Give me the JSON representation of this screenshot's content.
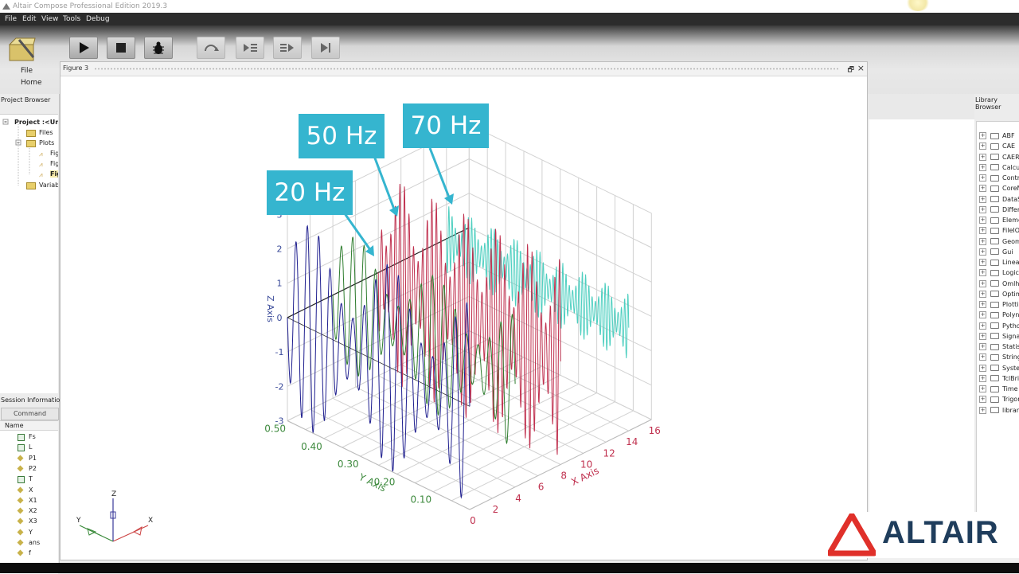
{
  "window": {
    "title": "Altair Compose Professional Edition 2019.3"
  },
  "menu": [
    "File",
    "Edit",
    "View",
    "Tools",
    "Debug"
  ],
  "ribbon": {
    "file_label": "File",
    "home_label": "Home"
  },
  "project_browser": {
    "title": "Project Browser",
    "project": "Project :<Untitled>",
    "files": "Files",
    "plots": "Plots",
    "figures": [
      "Fig",
      "Fig",
      "Fig"
    ],
    "variables": "Variables"
  },
  "session": {
    "title": "Session Information",
    "tab": "Command History",
    "column": "Name",
    "vars": [
      "Fs",
      "L",
      "P1",
      "P2",
      "T",
      "X",
      "X1",
      "X2",
      "X3",
      "Y",
      "ans",
      "f"
    ]
  },
  "figure": {
    "title": "Figure 3",
    "restore_glyph": "🗗",
    "close_glyph": "×"
  },
  "library": {
    "title": "Library Browser",
    "items": [
      "ABF",
      "CAE",
      "CAERead",
      "Calculus",
      "Control",
      "CoreMinimal",
      "DataStructures",
      "Differential",
      "ElementaryMath",
      "FileIO",
      "Geometry",
      "Gui",
      "LinearAlgebra",
      "Logical",
      "Omlh3",
      "Optimization",
      "Plotting",
      "Polynomial",
      "Python",
      "SignalProcessing",
      "StatisticalAnalysis",
      "StringOperations",
      "System",
      "TclBridge",
      "Time",
      "Trigonometry",
      "library"
    ]
  },
  "callouts": {
    "c20": "20 Hz",
    "c50": "50 Hz",
    "c70": "70 Hz"
  },
  "brand": {
    "name": "ALTAIR"
  },
  "colors": {
    "callout": "#35b5cf",
    "series_20hz": "#1f1f8f",
    "series_50hz": "#2e7d2e",
    "series_70hz_a": "#c0314f",
    "series_70hz_b": "#4ecfc0",
    "axis_z": "#3b4b9a",
    "axis_y": "#3e8a3e",
    "axis_x": "#c0314f"
  },
  "chart_data": {
    "type": "line",
    "projection": "3d",
    "xlabel": "X Axis",
    "ylabel": "Y Axis",
    "zlabel": "Z Axis",
    "x_ticks": [
      "0",
      "2",
      "4",
      "6",
      "8",
      "10",
      "12",
      "14",
      "16"
    ],
    "y_ticks": [
      "0.10",
      "0.20",
      "0.30",
      "0.40",
      "0.50"
    ],
    "z_ticks": [
      "-3",
      "-2",
      "-1",
      "0",
      "1",
      "2",
      "3"
    ],
    "xlim": [
      0,
      16
    ],
    "ylim": [
      0,
      0.5
    ],
    "zlim": [
      -3,
      3
    ],
    "series": [
      {
        "x": 0,
        "freq": 20,
        "amp": 3,
        "color": "#1f1f8f"
      },
      {
        "x": 4,
        "freq": 20,
        "amp": 2,
        "color": "#2e7d2e"
      },
      {
        "x": 8,
        "freq": 50,
        "amp": 3,
        "color": "#c0314f"
      },
      {
        "x": 14,
        "freq": 70,
        "amp": 1,
        "color": "#4ecfc0"
      }
    ]
  },
  "axes_triad": {
    "x": "X",
    "y": "Y",
    "z": "Z"
  }
}
